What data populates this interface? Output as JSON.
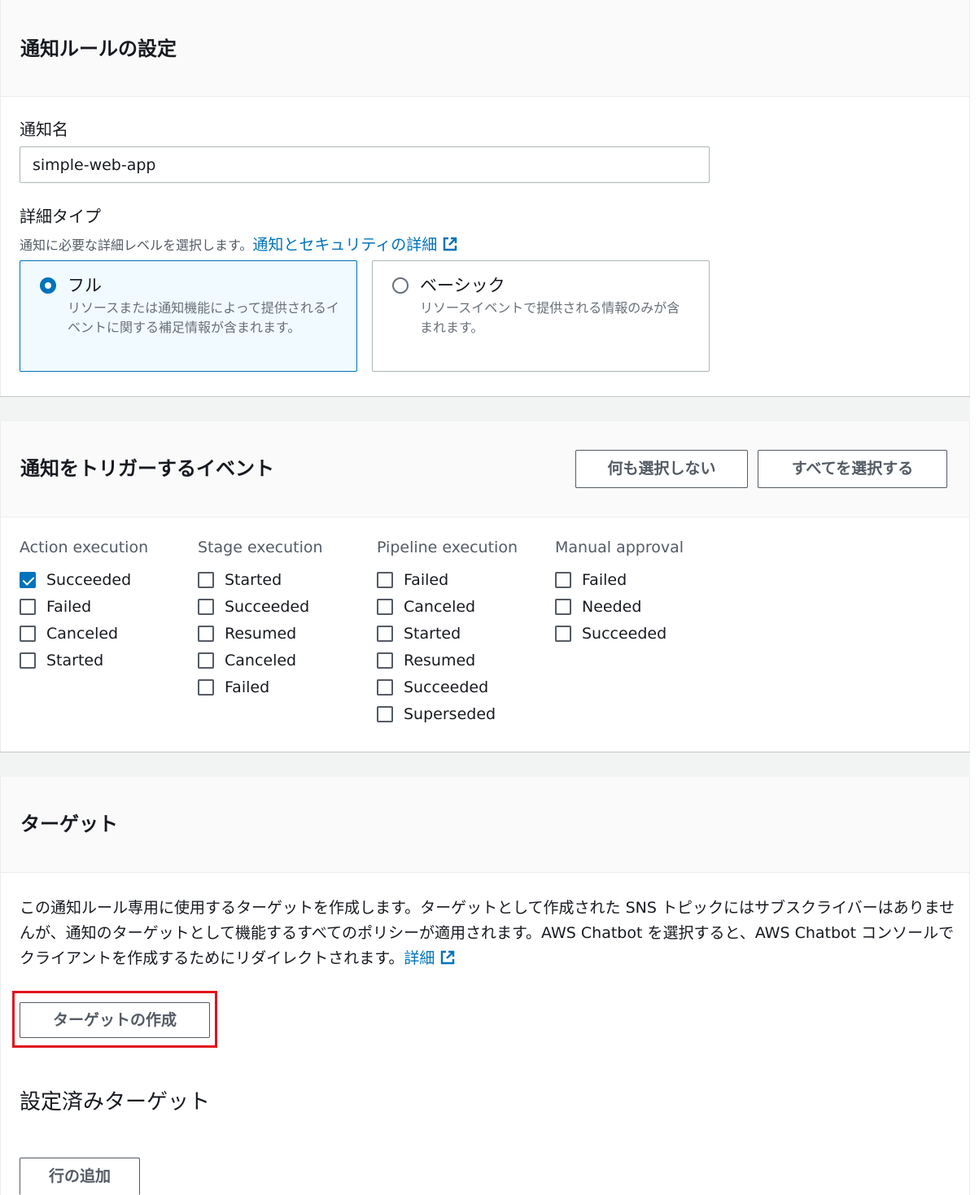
{
  "rule_settings": {
    "title": "通知ルールの設定",
    "name_label": "通知名",
    "name_value": "simple-web-app",
    "detail_label": "詳細タイプ",
    "detail_desc": "通知に必要な詳細レベルを選択します。",
    "detail_link": "通知とセキュリティの詳細",
    "options": [
      {
        "title": "フル",
        "desc": "リソースまたは通知機能によって提供されるイベントに関する補足情報が含まれます。",
        "selected": true
      },
      {
        "title": "ベーシック",
        "desc": "リソースイベントで提供される情報のみが含まれます。",
        "selected": false
      }
    ]
  },
  "events": {
    "title": "通知をトリガーするイベント",
    "select_none": "何も選択しない",
    "select_all": "すべてを選択する",
    "columns": [
      {
        "header": "Action execution",
        "items": [
          {
            "label": "Succeeded",
            "checked": true
          },
          {
            "label": "Failed",
            "checked": false
          },
          {
            "label": "Canceled",
            "checked": false
          },
          {
            "label": "Started",
            "checked": false
          }
        ]
      },
      {
        "header": "Stage execution",
        "items": [
          {
            "label": "Started",
            "checked": false
          },
          {
            "label": "Succeeded",
            "checked": false
          },
          {
            "label": "Resumed",
            "checked": false
          },
          {
            "label": "Canceled",
            "checked": false
          },
          {
            "label": "Failed",
            "checked": false
          }
        ]
      },
      {
        "header": "Pipeline execution",
        "items": [
          {
            "label": "Failed",
            "checked": false
          },
          {
            "label": "Canceled",
            "checked": false
          },
          {
            "label": "Started",
            "checked": false
          },
          {
            "label": "Resumed",
            "checked": false
          },
          {
            "label": "Succeeded",
            "checked": false
          },
          {
            "label": "Superseded",
            "checked": false
          }
        ]
      },
      {
        "header": "Manual approval",
        "items": [
          {
            "label": "Failed",
            "checked": false
          },
          {
            "label": "Needed",
            "checked": false
          },
          {
            "label": "Succeeded",
            "checked": false
          }
        ]
      }
    ]
  },
  "targets": {
    "title": "ターゲット",
    "description": "この通知ルール専用に使用するターゲットを作成します。ターゲットとして作成された SNS トピックにはサブスクライバーはありませんが、通知のターゲットとして機能するすべてのポリシーが適用されます。AWS Chatbot を選択すると、AWS Chatbot コンソールでクライアントを作成するためにリダイレクトされます。",
    "details_link": "詳細",
    "create_button": "ターゲットの作成",
    "configured_title": "設定済みターゲット",
    "add_row_button": "行の追加"
  },
  "colors": {
    "accent": "#0073bb",
    "highlight": "#e2101b"
  }
}
